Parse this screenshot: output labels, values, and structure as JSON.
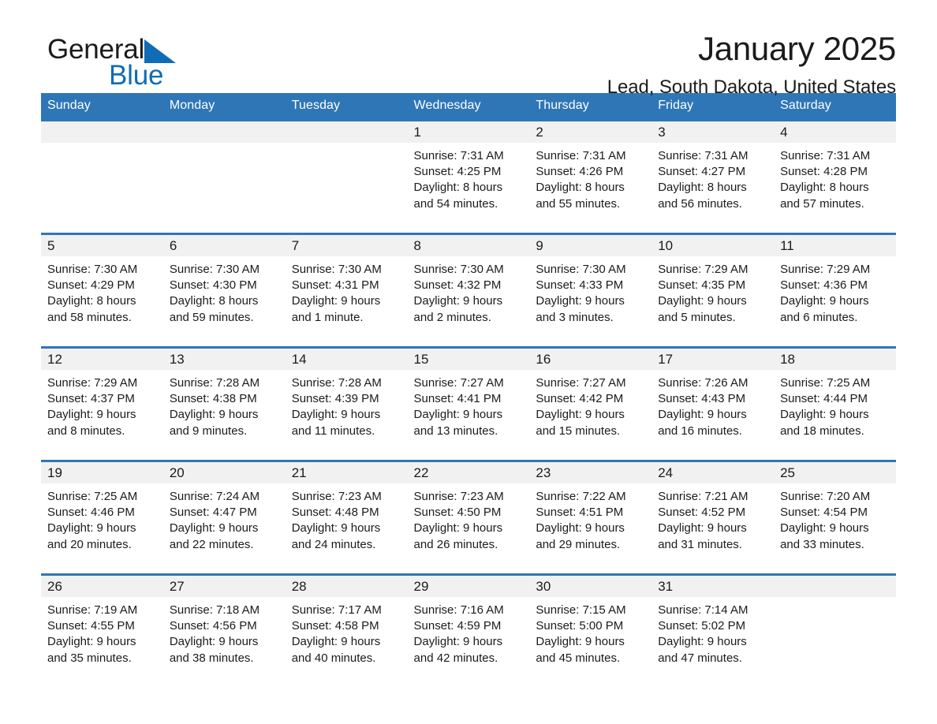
{
  "brand": {
    "name_part1": "General",
    "name_part2": "Blue",
    "accent_color": "#106cb5",
    "triangle_icon": "triangle-right-icon"
  },
  "header": {
    "title": "January 2025",
    "subtitle": "Lead, South Dakota, United States"
  },
  "theme": {
    "header_row_bg": "#2f76b6",
    "day_number_bg": "#f1f1f1",
    "separator_color": "#2f76b6",
    "text_color": "#1b1b1b"
  },
  "calendar": {
    "weekday_headers": [
      "Sunday",
      "Monday",
      "Tuesday",
      "Wednesday",
      "Thursday",
      "Friday",
      "Saturday"
    ],
    "weeks": [
      [
        {
          "day": "",
          "empty": true
        },
        {
          "day": "",
          "empty": true
        },
        {
          "day": "",
          "empty": true
        },
        {
          "day": "1",
          "sunrise": "Sunrise: 7:31 AM",
          "sunset": "Sunset: 4:25 PM",
          "daylight_line1": "Daylight: 8 hours",
          "daylight_line2": "and 54 minutes."
        },
        {
          "day": "2",
          "sunrise": "Sunrise: 7:31 AM",
          "sunset": "Sunset: 4:26 PM",
          "daylight_line1": "Daylight: 8 hours",
          "daylight_line2": "and 55 minutes."
        },
        {
          "day": "3",
          "sunrise": "Sunrise: 7:31 AM",
          "sunset": "Sunset: 4:27 PM",
          "daylight_line1": "Daylight: 8 hours",
          "daylight_line2": "and 56 minutes."
        },
        {
          "day": "4",
          "sunrise": "Sunrise: 7:31 AM",
          "sunset": "Sunset: 4:28 PM",
          "daylight_line1": "Daylight: 8 hours",
          "daylight_line2": "and 57 minutes."
        }
      ],
      [
        {
          "day": "5",
          "sunrise": "Sunrise: 7:30 AM",
          "sunset": "Sunset: 4:29 PM",
          "daylight_line1": "Daylight: 8 hours",
          "daylight_line2": "and 58 minutes."
        },
        {
          "day": "6",
          "sunrise": "Sunrise: 7:30 AM",
          "sunset": "Sunset: 4:30 PM",
          "daylight_line1": "Daylight: 8 hours",
          "daylight_line2": "and 59 minutes."
        },
        {
          "day": "7",
          "sunrise": "Sunrise: 7:30 AM",
          "sunset": "Sunset: 4:31 PM",
          "daylight_line1": "Daylight: 9 hours",
          "daylight_line2": "and 1 minute."
        },
        {
          "day": "8",
          "sunrise": "Sunrise: 7:30 AM",
          "sunset": "Sunset: 4:32 PM",
          "daylight_line1": "Daylight: 9 hours",
          "daylight_line2": "and 2 minutes."
        },
        {
          "day": "9",
          "sunrise": "Sunrise: 7:30 AM",
          "sunset": "Sunset: 4:33 PM",
          "daylight_line1": "Daylight: 9 hours",
          "daylight_line2": "and 3 minutes."
        },
        {
          "day": "10",
          "sunrise": "Sunrise: 7:29 AM",
          "sunset": "Sunset: 4:35 PM",
          "daylight_line1": "Daylight: 9 hours",
          "daylight_line2": "and 5 minutes."
        },
        {
          "day": "11",
          "sunrise": "Sunrise: 7:29 AM",
          "sunset": "Sunset: 4:36 PM",
          "daylight_line1": "Daylight: 9 hours",
          "daylight_line2": "and 6 minutes."
        }
      ],
      [
        {
          "day": "12",
          "sunrise": "Sunrise: 7:29 AM",
          "sunset": "Sunset: 4:37 PM",
          "daylight_line1": "Daylight: 9 hours",
          "daylight_line2": "and 8 minutes."
        },
        {
          "day": "13",
          "sunrise": "Sunrise: 7:28 AM",
          "sunset": "Sunset: 4:38 PM",
          "daylight_line1": "Daylight: 9 hours",
          "daylight_line2": "and 9 minutes."
        },
        {
          "day": "14",
          "sunrise": "Sunrise: 7:28 AM",
          "sunset": "Sunset: 4:39 PM",
          "daylight_line1": "Daylight: 9 hours",
          "daylight_line2": "and 11 minutes."
        },
        {
          "day": "15",
          "sunrise": "Sunrise: 7:27 AM",
          "sunset": "Sunset: 4:41 PM",
          "daylight_line1": "Daylight: 9 hours",
          "daylight_line2": "and 13 minutes."
        },
        {
          "day": "16",
          "sunrise": "Sunrise: 7:27 AM",
          "sunset": "Sunset: 4:42 PM",
          "daylight_line1": "Daylight: 9 hours",
          "daylight_line2": "and 15 minutes."
        },
        {
          "day": "17",
          "sunrise": "Sunrise: 7:26 AM",
          "sunset": "Sunset: 4:43 PM",
          "daylight_line1": "Daylight: 9 hours",
          "daylight_line2": "and 16 minutes."
        },
        {
          "day": "18",
          "sunrise": "Sunrise: 7:25 AM",
          "sunset": "Sunset: 4:44 PM",
          "daylight_line1": "Daylight: 9 hours",
          "daylight_line2": "and 18 minutes."
        }
      ],
      [
        {
          "day": "19",
          "sunrise": "Sunrise: 7:25 AM",
          "sunset": "Sunset: 4:46 PM",
          "daylight_line1": "Daylight: 9 hours",
          "daylight_line2": "and 20 minutes."
        },
        {
          "day": "20",
          "sunrise": "Sunrise: 7:24 AM",
          "sunset": "Sunset: 4:47 PM",
          "daylight_line1": "Daylight: 9 hours",
          "daylight_line2": "and 22 minutes."
        },
        {
          "day": "21",
          "sunrise": "Sunrise: 7:23 AM",
          "sunset": "Sunset: 4:48 PM",
          "daylight_line1": "Daylight: 9 hours",
          "daylight_line2": "and 24 minutes."
        },
        {
          "day": "22",
          "sunrise": "Sunrise: 7:23 AM",
          "sunset": "Sunset: 4:50 PM",
          "daylight_line1": "Daylight: 9 hours",
          "daylight_line2": "and 26 minutes."
        },
        {
          "day": "23",
          "sunrise": "Sunrise: 7:22 AM",
          "sunset": "Sunset: 4:51 PM",
          "daylight_line1": "Daylight: 9 hours",
          "daylight_line2": "and 29 minutes."
        },
        {
          "day": "24",
          "sunrise": "Sunrise: 7:21 AM",
          "sunset": "Sunset: 4:52 PM",
          "daylight_line1": "Daylight: 9 hours",
          "daylight_line2": "and 31 minutes."
        },
        {
          "day": "25",
          "sunrise": "Sunrise: 7:20 AM",
          "sunset": "Sunset: 4:54 PM",
          "daylight_line1": "Daylight: 9 hours",
          "daylight_line2": "and 33 minutes."
        }
      ],
      [
        {
          "day": "26",
          "sunrise": "Sunrise: 7:19 AM",
          "sunset": "Sunset: 4:55 PM",
          "daylight_line1": "Daylight: 9 hours",
          "daylight_line2": "and 35 minutes."
        },
        {
          "day": "27",
          "sunrise": "Sunrise: 7:18 AM",
          "sunset": "Sunset: 4:56 PM",
          "daylight_line1": "Daylight: 9 hours",
          "daylight_line2": "and 38 minutes."
        },
        {
          "day": "28",
          "sunrise": "Sunrise: 7:17 AM",
          "sunset": "Sunset: 4:58 PM",
          "daylight_line1": "Daylight: 9 hours",
          "daylight_line2": "and 40 minutes."
        },
        {
          "day": "29",
          "sunrise": "Sunrise: 7:16 AM",
          "sunset": "Sunset: 4:59 PM",
          "daylight_line1": "Daylight: 9 hours",
          "daylight_line2": "and 42 minutes."
        },
        {
          "day": "30",
          "sunrise": "Sunrise: 7:15 AM",
          "sunset": "Sunset: 5:00 PM",
          "daylight_line1": "Daylight: 9 hours",
          "daylight_line2": "and 45 minutes."
        },
        {
          "day": "31",
          "sunrise": "Sunrise: 7:14 AM",
          "sunset": "Sunset: 5:02 PM",
          "daylight_line1": "Daylight: 9 hours",
          "daylight_line2": "and 47 minutes."
        },
        {
          "day": "",
          "empty": true
        }
      ]
    ]
  }
}
